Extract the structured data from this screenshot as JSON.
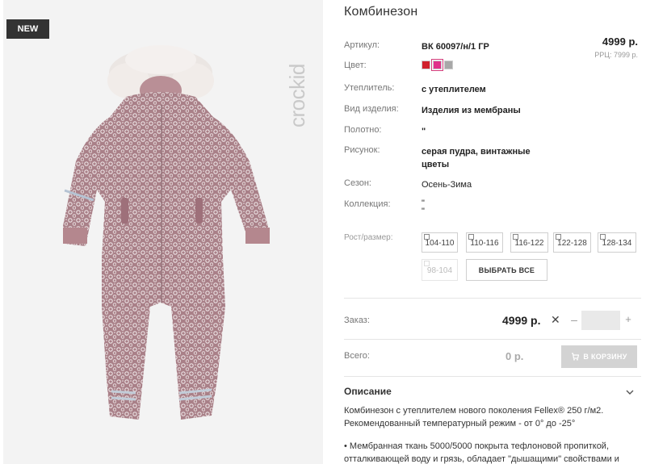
{
  "badge": "NEW",
  "brand": "crockid",
  "product": {
    "title": "Комбинезон",
    "price": "4999 р.",
    "rrp": "РРЦ: 7999 р.",
    "specs": [
      {
        "label": "Артикул:",
        "value": "ВК 60097/н/1 ГР"
      },
      {
        "label": "Цвет:",
        "value": ""
      },
      {
        "label": "Утеплитель:",
        "value": "с утеплителем"
      },
      {
        "label": "Вид изделия:",
        "value": "Изделия из мембраны"
      },
      {
        "label": "Полотно:",
        "value": "\""
      },
      {
        "label": "Рисунок:",
        "value": "серая пудра, винтажные цветы"
      },
      {
        "label": "Сезон:",
        "value": "Осень-Зима"
      },
      {
        "label": "Коллекция:",
        "value": "\"\n\""
      }
    ],
    "colors": [
      "#d0202c",
      "#e0308a",
      "#a8a8a8"
    ],
    "size_label": "Рост/размер:",
    "sizes": [
      "104-110",
      "110-116",
      "116-122",
      "122-128",
      "128-134"
    ],
    "sizes_disabled": [
      "98-104"
    ],
    "select_all": "ВЫБРАТЬ ВСЕ"
  },
  "order": {
    "label": "Заказ:",
    "price": "4999 р.",
    "times": "✕",
    "minus": "–",
    "plus": "+",
    "quantity": ""
  },
  "total": {
    "label": "Всего:",
    "value": "0 р.",
    "cart_button": "В КОРЗИНУ"
  },
  "description": {
    "title": "Описание",
    "text1": "Комбинезон с утеплителем нового поколения Fellex® 250 г/м2. Рекомендованный температурный режим - от 0° до -25°",
    "text2": "• Мембранная ткань 5000/5000 покрыта тефлоновой пропиткой, отталкивающей воду и грязь, обладает \"дышащими\" свойствами и"
  }
}
